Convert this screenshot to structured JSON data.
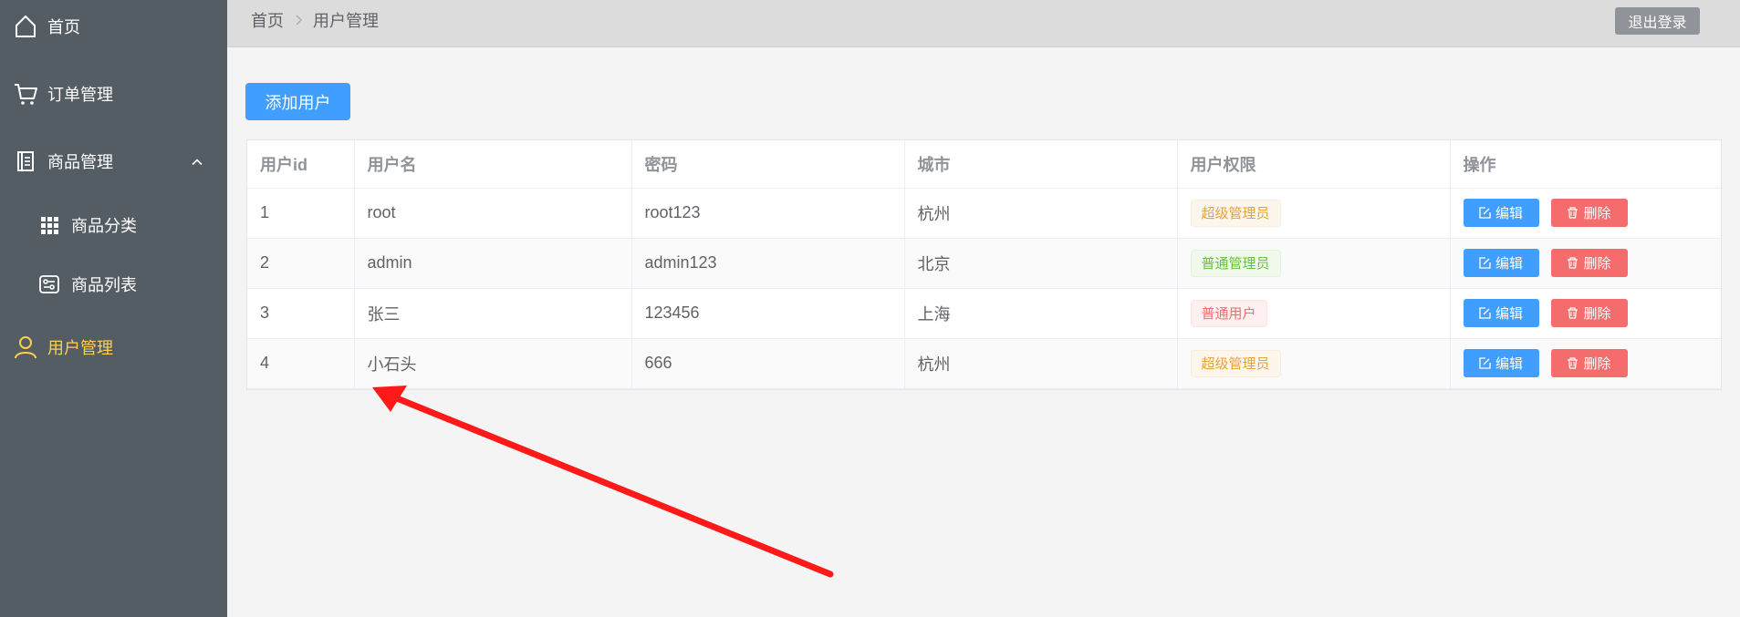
{
  "sidebar": {
    "items": [
      {
        "label": "首页",
        "icon": "home-icon"
      },
      {
        "label": "订单管理",
        "icon": "cart-icon"
      },
      {
        "label": "商品管理",
        "icon": "document-icon",
        "expanded": true
      },
      {
        "label": "商品分类",
        "icon": "grid-icon"
      },
      {
        "label": "商品列表",
        "icon": "list-settings-icon"
      },
      {
        "label": "用户管理",
        "icon": "user-icon",
        "active": true
      }
    ],
    "background": "#545c64",
    "active_color": "#ffd04b"
  },
  "header": {
    "breadcrumb": [
      "首页",
      "用户管理"
    ],
    "logout_label": "退出登录"
  },
  "main": {
    "add_user_label": "添加用户",
    "table": {
      "columns": [
        "用户id",
        "用户名",
        "密码",
        "城市",
        "用户权限",
        "操作"
      ],
      "rows": [
        {
          "id": "1",
          "username": "root",
          "password": "root123",
          "city": "杭州",
          "role": "超级管理员",
          "role_type": "warning"
        },
        {
          "id": "2",
          "username": "admin",
          "password": "admin123",
          "city": "北京",
          "role": "普通管理员",
          "role_type": "success"
        },
        {
          "id": "3",
          "username": "张三",
          "password": "123456",
          "city": "上海",
          "role": "普通用户",
          "role_type": "danger"
        },
        {
          "id": "4",
          "username": "小石头",
          "password": "666",
          "city": "杭州",
          "role": "超级管理员",
          "role_type": "warning"
        }
      ],
      "edit_label": "编辑",
      "delete_label": "删除"
    }
  },
  "colors": {
    "primary": "#409eff",
    "danger": "#f56c6c",
    "warning": "#e6a23c",
    "success": "#67c23a",
    "annotation": "#ff1a1a"
  }
}
